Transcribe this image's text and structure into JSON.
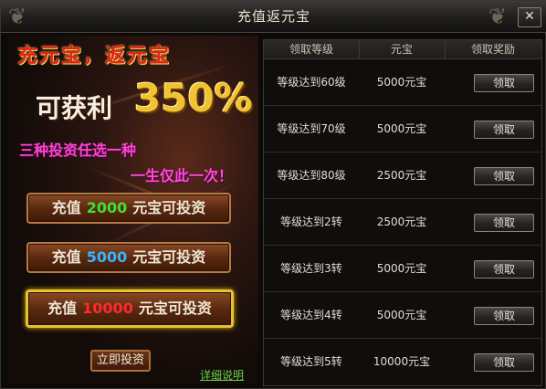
{
  "window": {
    "title": "充值返元宝",
    "close_label": "✕"
  },
  "promo": {
    "headline": "充元宝，返元宝",
    "profit_label": "可获利",
    "profit_value": "350%",
    "choose_text": "三种投资任选一种",
    "once_text": "一生仅此一次！",
    "options": [
      {
        "pre": "充值",
        "amount": "2000",
        "post": "元宝可投资",
        "amount_color": "#44dd33"
      },
      {
        "pre": "充值",
        "amount": "5000",
        "post": "元宝可投资",
        "amount_color": "#3ab4ff"
      },
      {
        "pre": "充值",
        "amount": "10000",
        "post": "元宝可投资",
        "amount_color": "#ff2a2a"
      }
    ],
    "invest_now_label": "立即投资",
    "details_link": "详细说明"
  },
  "table": {
    "headers": [
      "领取等级",
      "元宝",
      "领取奖励"
    ],
    "rows": [
      {
        "level": "等级达到60级",
        "amount": "5000元宝",
        "action": "领取"
      },
      {
        "level": "等级达到70级",
        "amount": "5000元宝",
        "action": "领取"
      },
      {
        "level": "等级达到80级",
        "amount": "2500元宝",
        "action": "领取"
      },
      {
        "level": "等级达到2转",
        "amount": "2500元宝",
        "action": "领取"
      },
      {
        "level": "等级达到3转",
        "amount": "5000元宝",
        "action": "领取"
      },
      {
        "level": "等级达到4转",
        "amount": "5000元宝",
        "action": "领取"
      },
      {
        "level": "等级达到5转",
        "amount": "10000元宝",
        "action": "领取"
      }
    ]
  },
  "colors": {
    "accent_gold": "#e7c233",
    "title_red": "#e0231a",
    "link_green": "#6ad14b",
    "magenta": "#ff45d2"
  }
}
